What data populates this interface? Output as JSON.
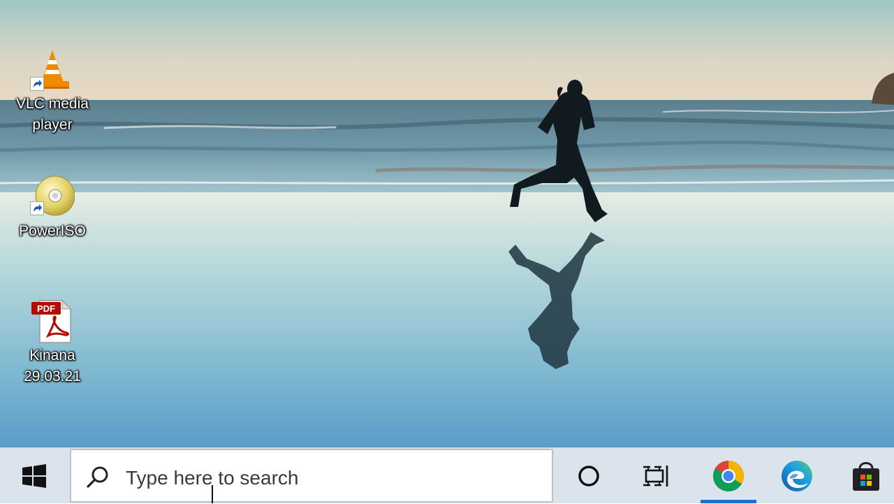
{
  "desktop": {
    "icons": [
      {
        "label": "VLC media player",
        "icon": "vlc-cone-icon"
      },
      {
        "label": "PowerISO",
        "icon": "disc-icon"
      },
      {
        "label": "Kinana 29.03.21",
        "icon": "pdf-file-icon",
        "badge": "PDF"
      }
    ],
    "wallpaper": "beach-runner-reflection"
  },
  "taskbar": {
    "start_icon": "windows-logo-icon",
    "search": {
      "placeholder": "Type here to search",
      "icon": "search-icon"
    },
    "buttons": [
      {
        "icon": "cortana-icon"
      },
      {
        "icon": "task-view-icon"
      },
      {
        "icon": "chrome-icon",
        "active": true
      },
      {
        "icon": "edge-icon"
      },
      {
        "icon": "store-icon"
      }
    ],
    "colors": {
      "background": "#dbe3ec",
      "active_indicator": "#1f6fd1"
    }
  }
}
